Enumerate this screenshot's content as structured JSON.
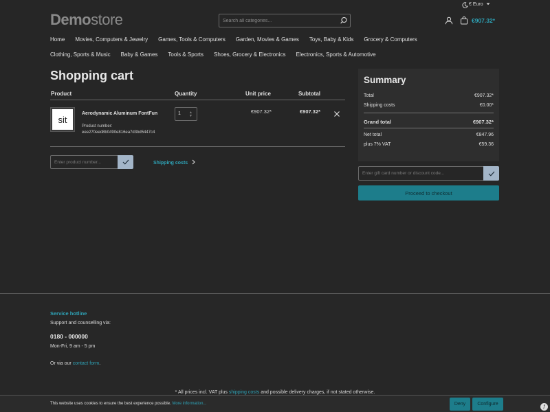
{
  "header": {
    "logo_bold": "Demo",
    "logo_light": "store",
    "search_placeholder": "Search all categories...",
    "currency": "€ Euro",
    "cart_total": "€907.32*",
    "icons": [
      "moon-icon",
      "search-icon",
      "account-icon",
      "cart-icon",
      "chevron-down-icon"
    ]
  },
  "nav": {
    "row1": [
      "Home",
      "Movies, Computers & Jewelry",
      "Games, Tools & Computers",
      "Garden, Movies & Games",
      "Toys, Baby & Kids",
      "Grocery & Computers"
    ],
    "row2": [
      "Clothing, Sports & Music",
      "Baby & Games",
      "Tools & Sports",
      "Shoes, Grocery & Electronics",
      "Electronics, Sports & Automotive"
    ]
  },
  "cart": {
    "title": "Shopping cart",
    "headers": {
      "product": "Product",
      "quantity": "Quantity",
      "unit_price": "Unit price",
      "subtotal": "Subtotal"
    },
    "item": {
      "thumb": "sit",
      "name": "Aerodynamic Aluminum FontFun",
      "number_label": "Product number:",
      "number": "eee270eed8b0490e816ea7d3bd5447c4",
      "quantity": "1",
      "unit_price": "€907.32*",
      "subtotal": "€907.32*"
    },
    "product_number_placeholder": "Enter product number...",
    "shipping_costs": "Shipping costs"
  },
  "summary": {
    "title": "Summary",
    "total_label": "Total",
    "total": "€907.32*",
    "shipping_label": "Shipping costs",
    "shipping": "€0.00*",
    "grand_label": "Grand total",
    "grand": "€907.32*",
    "net_label": "Net total",
    "net": "€847.96",
    "vat_label": "plus 7% VAT",
    "vat": "€59.36",
    "gift_placeholder": "Enter gift card number or discount code...",
    "checkout": "Proceed to checkout"
  },
  "footer": {
    "hotline_title": "Service hotline",
    "support": "Support and counselling via:",
    "phone": "0180 - 000000",
    "hours": "Mon-Fri, 9 am - 5 pm",
    "or_via": "Or via our",
    "contact_form": "contact form",
    "dot": ".",
    "vat_note_prefix": "* All prices incl. VAT plus",
    "vat_note_link": "shipping costs",
    "vat_note_suffix": "and possible delivery charges, if not stated otherwise."
  },
  "cookie": {
    "text": "This website uses cookies to ensure the best experience possible.",
    "more": "More information...",
    "deny": "Deny",
    "configure": "Configure"
  },
  "colors": {
    "accent": "#2ea3b7",
    "button": "#1d7d8b",
    "background": "#262626"
  }
}
